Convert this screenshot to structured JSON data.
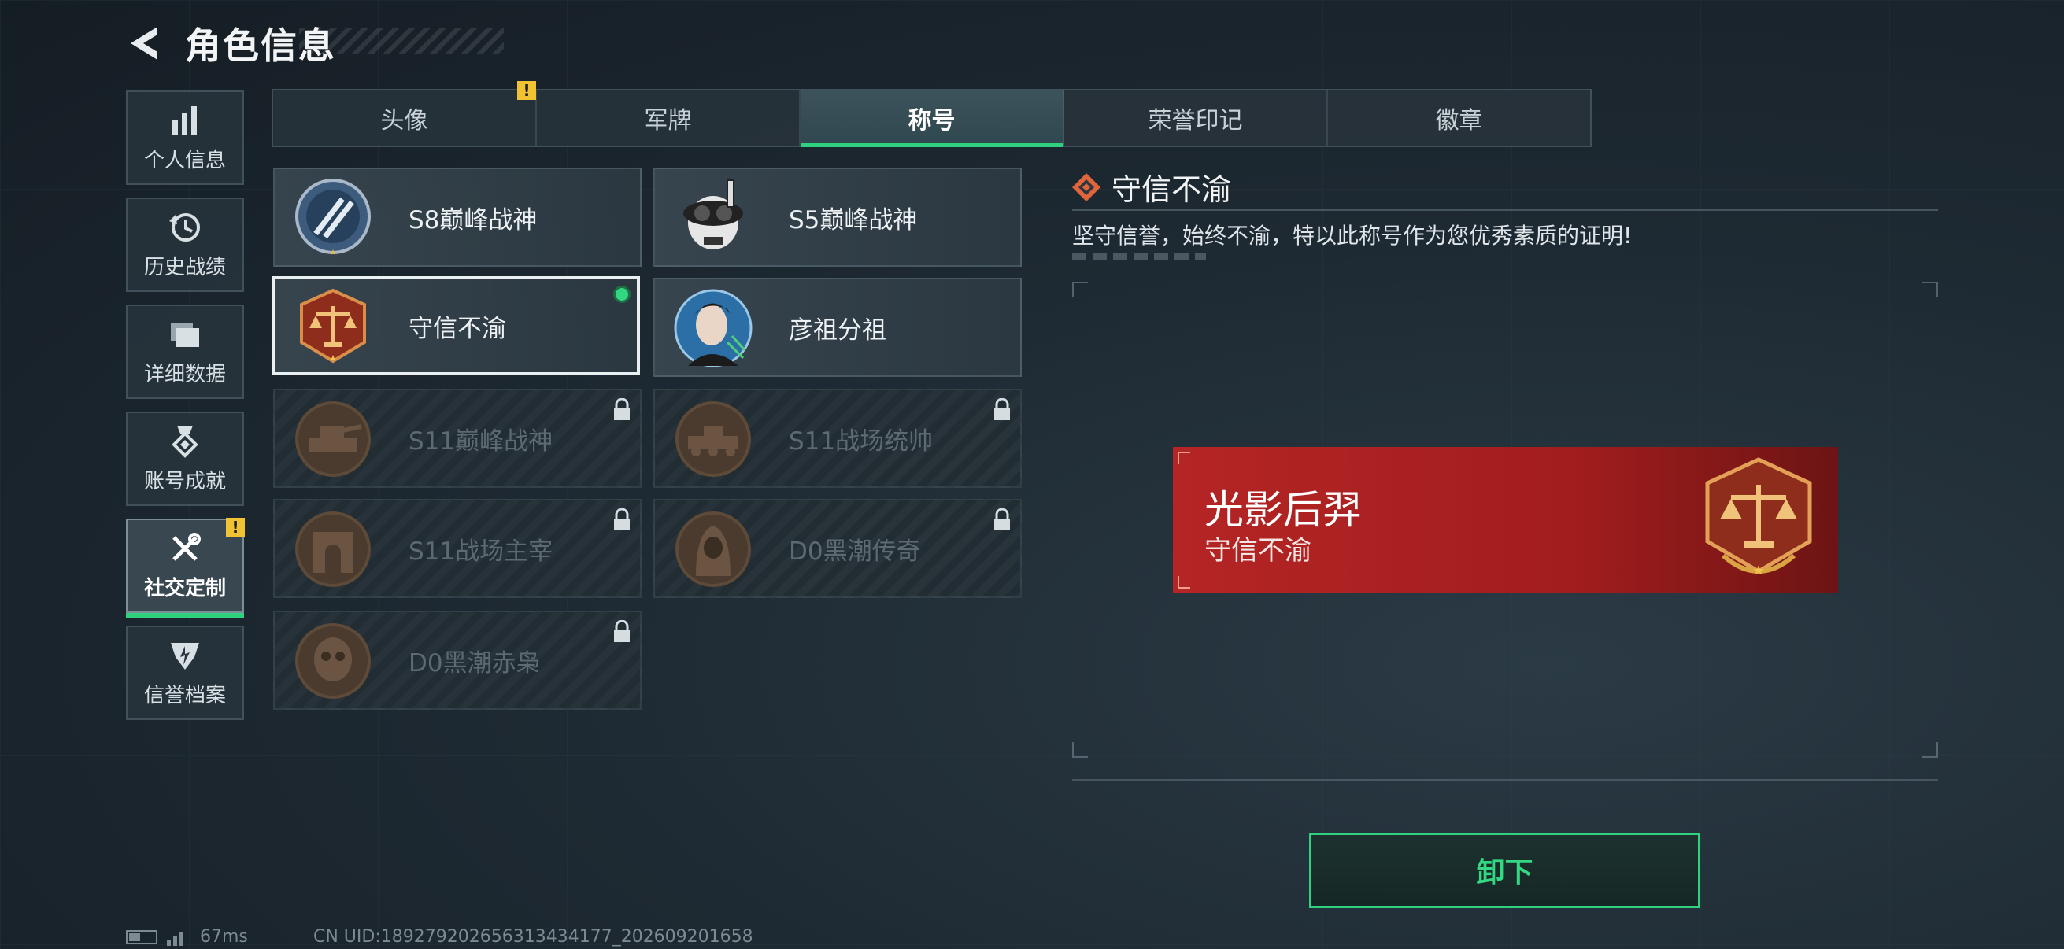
{
  "header": {
    "title": "角色信息"
  },
  "sidebar": {
    "items": [
      {
        "label": "个人信息",
        "icon": "bar-chart-icon"
      },
      {
        "label": "历史战绩",
        "icon": "history-clock-icon"
      },
      {
        "label": "详细数据",
        "icon": "folder-icon"
      },
      {
        "label": "账号成就",
        "icon": "achievement-medal-icon"
      },
      {
        "label": "社交定制",
        "icon": "tools-icon",
        "active": true,
        "alert": "!"
      },
      {
        "label": "信誉档案",
        "icon": "reputation-shield-icon"
      }
    ]
  },
  "tabs": [
    {
      "label": "头像",
      "alert": "!"
    },
    {
      "label": "军牌"
    },
    {
      "label": "称号",
      "active": true
    },
    {
      "label": "荣誉印记"
    },
    {
      "label": "徽章"
    }
  ],
  "titles": [
    {
      "name": "S8巅峰战神",
      "locked": false
    },
    {
      "name": "S5巅峰战神",
      "locked": false
    },
    {
      "name": "守信不渝",
      "locked": false,
      "selected": true,
      "equipped": true
    },
    {
      "name": "彦祖分祖",
      "locked": false
    },
    {
      "name": "S11巅峰战神",
      "locked": true
    },
    {
      "name": "S11战场统帅",
      "locked": true
    },
    {
      "name": "S11战场主宰",
      "locked": true
    },
    {
      "name": "D0黑潮传奇",
      "locked": true
    },
    {
      "name": "D0黑潮赤枭",
      "locked": true
    }
  ],
  "detail": {
    "title": "守信不渝",
    "description": "坚守信誉，始终不渝，特以此称号作为您优秀素质的证明!",
    "preview": {
      "player_name": "光影后羿",
      "title": "守信不渝"
    },
    "action_label": "卸下"
  },
  "status": {
    "ping": "67ms",
    "uid": "CN UID:18927920265631343417​7_202609201658"
  },
  "colors": {
    "accent_green": "#2fd07e",
    "banner_red": "#b52525",
    "warning_yellow": "#f1c232"
  }
}
